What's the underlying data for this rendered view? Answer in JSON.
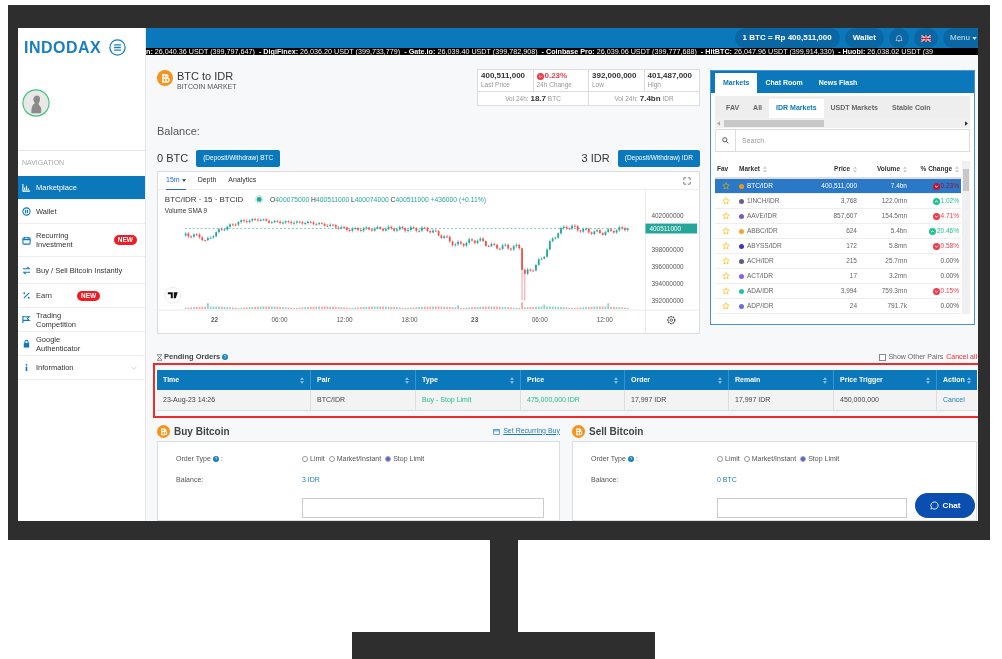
{
  "brand": {
    "logo": "INDODAX"
  },
  "sidebar": {
    "section_label": "NAVIGATION",
    "items": [
      {
        "label": "Marketplace",
        "kind": "chart",
        "selected": true
      },
      {
        "label": "Wallet",
        "kind": "coin",
        "selected": false
      },
      {
        "label": "Recurring Investment",
        "kind": "calendar",
        "badge": "NEW",
        "selected": false
      },
      {
        "label": "Buy / Sell Bitcoin Instantly",
        "kind": "swap",
        "selected": false
      },
      {
        "label": "Earn",
        "kind": "percent",
        "badge": "NEW",
        "selected": false
      },
      {
        "label": "Trading Competition",
        "kind": "flag",
        "selected": false
      },
      {
        "label": "Google Authenticator",
        "kind": "lock",
        "selected": false
      },
      {
        "label": "Information",
        "kind": "info",
        "selected": false
      }
    ]
  },
  "topbar": {
    "rate": "1 BTC = Rp 400,511,000",
    "wallet": "Wallet",
    "menu": "Menu"
  },
  "ticker": [
    {
      "exchange": "n:",
      "price": "26,040.36 USDT (399,797,647)"
    },
    {
      "exchange": "- DigiFinex:",
      "price": "26,036.20 USDT (399,733,779)"
    },
    {
      "exchange": "- Gate.io:",
      "price": "26,039.40 USDT (399,782,908)"
    },
    {
      "exchange": "- Coinbase Pro:",
      "price": "26,039.06 USDT (399,777,688)"
    },
    {
      "exchange": "- HitBTC:",
      "price": "26,047.96 USDT (399,914,330)"
    },
    {
      "exchange": "- Huobi:",
      "price": "26,038.02 USDT (39"
    }
  ],
  "market_header": {
    "title": "BTC to IDR",
    "subtitle": "BITCOIN MARKET"
  },
  "stats": {
    "cells": [
      {
        "value": "400,511,000",
        "label": "Last Price",
        "kind": "plain"
      },
      {
        "value": "0.23%",
        "label": "24h Change",
        "kind": "down"
      },
      {
        "value": "392,000,000",
        "label": "Low",
        "kind": "plain"
      },
      {
        "value": "401,487,000",
        "label": "High",
        "kind": "plain"
      }
    ],
    "volumes": [
      {
        "label": "Vol 24h:",
        "value": "18.7",
        "unit": "BTC"
      },
      {
        "label": "Vol 24h:",
        "value": "7.4bn",
        "unit": "IDR"
      }
    ]
  },
  "balance": {
    "title": "Balance:",
    "items": [
      {
        "amount": "0 BTC",
        "button": "(Deposit/Withdraw) BTC"
      },
      {
        "amount": "3 IDR",
        "button": "(Deposit/Withdraw) IDR"
      }
    ]
  },
  "chart": {
    "tabs": [
      {
        "label": "15m",
        "selected": true,
        "dropdown": true
      },
      {
        "label": "Depth",
        "selected": false,
        "dropdown": false
      },
      {
        "label": "Analytics",
        "selected": false,
        "dropdown": false
      }
    ],
    "symbol": "BTC/IDR · 15 · BTCID",
    "ohlc": [
      {
        "key": "O",
        "value": "400075000"
      },
      {
        "key": "H",
        "value": "400511000"
      },
      {
        "key": "L",
        "value": "400074000"
      },
      {
        "key": "C",
        "value": "400511000"
      }
    ],
    "change": "+436000 (+0.11%)",
    "volume_label": "Volume SMA 9",
    "price_ticks": [
      "402000000",
      "398000000",
      "396000000",
      "394000000",
      "392000000"
    ],
    "last_price_tag": "400511000",
    "time_ticks": [
      "22",
      "06:00",
      "12:00",
      "18:00",
      "23",
      "06:00",
      "12:00"
    ]
  },
  "markets": {
    "tabs": [
      {
        "label": "Markets",
        "selected": true
      },
      {
        "label": "Chat Room",
        "selected": false
      },
      {
        "label": "News Flash",
        "selected": false
      }
    ],
    "subtabs": [
      {
        "label": "FAV",
        "selected": false
      },
      {
        "label": "All",
        "selected": false
      },
      {
        "label": "IDR Markets",
        "selected": true
      },
      {
        "label": "USDT Markets",
        "selected": false
      },
      {
        "label": "Stable Coin",
        "selected": false
      }
    ],
    "search_placeholder": "Search",
    "columns": [
      "Fav",
      "Market",
      "Price",
      "Volume",
      "% Change"
    ],
    "rows": [
      {
        "market": "BTC/IDR",
        "price": "400,511,000",
        "volume": "7.4bn",
        "change": "0.23%",
        "kind": "down",
        "color": "#f7931a",
        "selected": true
      },
      {
        "market": "1INCH/IDR",
        "price": "3,768",
        "volume": "122.0mn",
        "change": "1.02%",
        "kind": "up",
        "color": "#6b5b8c",
        "selected": false
      },
      {
        "market": "AAVE/IDR",
        "price": "857,607",
        "volume": "154.5mn",
        "change": "4.71%",
        "kind": "down",
        "color": "#7a5cc0",
        "selected": false
      },
      {
        "market": "ABBC/IDR",
        "price": "624",
        "volume": "5.4bn",
        "change": "20.46%",
        "kind": "up",
        "color": "#f5a623",
        "selected": false
      },
      {
        "market": "ABYSS/IDR",
        "price": "172",
        "volume": "5.8mn",
        "change": "0.58%",
        "kind": "down",
        "color": "#4b2fc0",
        "selected": false
      },
      {
        "market": "ACH/IDR",
        "price": "215",
        "volume": "25.7mn",
        "change": "0.00%",
        "kind": "flat",
        "color": "#5a5a8a",
        "selected": false
      },
      {
        "market": "ACT/IDR",
        "price": "17",
        "volume": "3.2mn",
        "change": "0.00%",
        "kind": "flat",
        "color": "#8b5cf6",
        "selected": false
      },
      {
        "market": "ADA/IDR",
        "price": "3,994",
        "volume": "759.3mn",
        "change": "0.15%",
        "kind": "down",
        "color": "#20c0b0",
        "selected": false
      },
      {
        "market": "ADP/IDR",
        "price": "24",
        "volume": "791.7k",
        "change": "0.00%",
        "kind": "flat",
        "color": "#6a6af0",
        "selected": false
      }
    ]
  },
  "pending_orders": {
    "title": "Pending Orders",
    "highlighted": true,
    "show_other_pairs": {
      "label": "Show Other Pairs",
      "checked": false
    },
    "cancel_all": "Cancel all",
    "columns": [
      "Time",
      "Pair",
      "Type",
      "Price",
      "Order",
      "Remain",
      "Price Trigger",
      "Action"
    ],
    "rows": [
      {
        "time": "23-Aug-23 14:26",
        "pair": "BTC/IDR",
        "type": "Buy - Stop Limit",
        "price": "475,000,000 IDR",
        "order": "17,997 IDR",
        "remain": "17,997 IDR",
        "price_trigger": "450,000,000",
        "action": "Cancel",
        "kind": "buy"
      }
    ]
  },
  "trade_panels": [
    {
      "title": "Buy Bitcoin",
      "link": "Set Recurring Buy",
      "order_type_label": "Order Type",
      "colon": ":",
      "options": [
        {
          "label": "Limit",
          "selected": false
        },
        {
          "label": "Market/Instant",
          "selected": false
        },
        {
          "label": "Stop Limit",
          "selected": true
        }
      ],
      "balance_label": "Balance:",
      "balance": "3 IDR"
    },
    {
      "title": "Sell Bitcoin",
      "order_type_label": "Order Type",
      "colon": ":",
      "options": [
        {
          "label": "Limit",
          "selected": false
        },
        {
          "label": "Market/Instant",
          "selected": false
        },
        {
          "label": "Stop Limit",
          "selected": true
        }
      ],
      "balance_label": "Balance:",
      "balance": "0 BTC"
    }
  ],
  "chat": {
    "label": "Chat"
  }
}
